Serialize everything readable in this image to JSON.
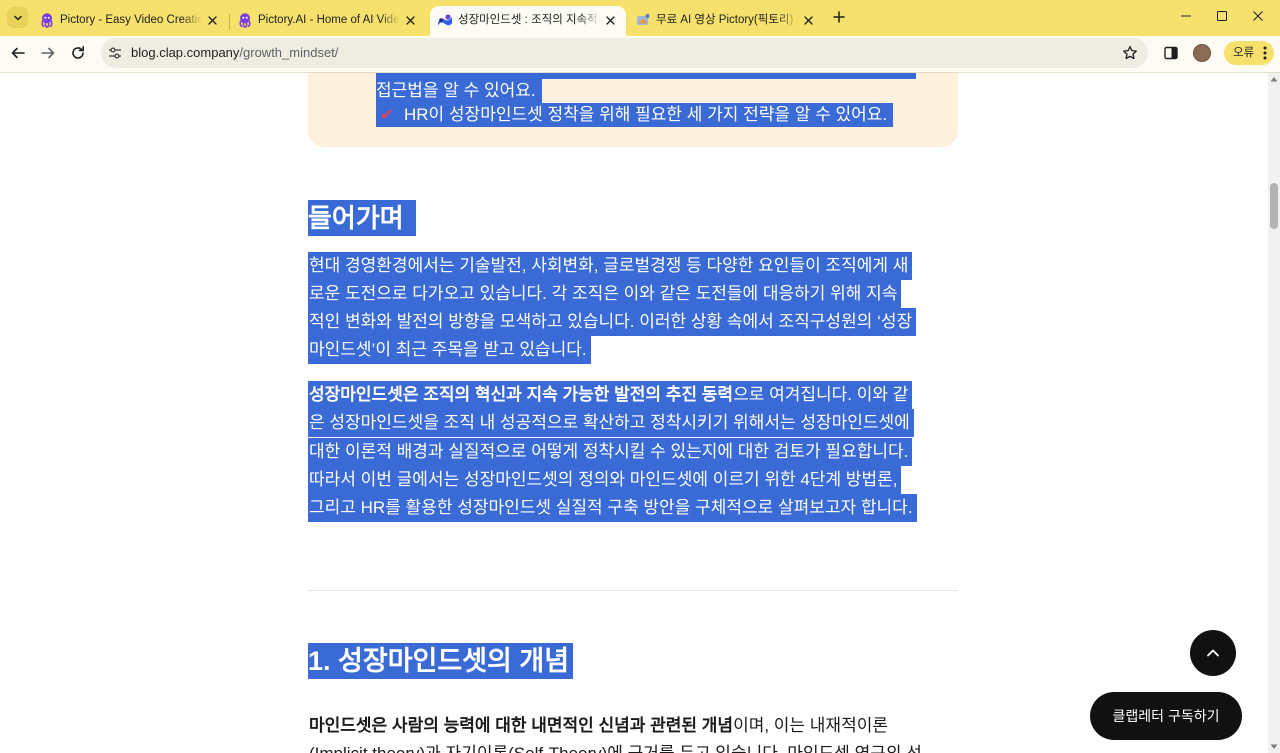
{
  "theme": {
    "frame_color": "#f5e16b",
    "toolbar_color": "#fdfcf4",
    "selection_color": "#3a6ad6",
    "summary_box_color": "#fdf1dd",
    "check_color": "#e8415f",
    "floating_button_color": "#111111"
  },
  "browser": {
    "tab_search_icon": "chevron-down-icon",
    "tabs": [
      {
        "title": "Pictory - Easy Video Creation",
        "icon": "pictory-octopus-icon",
        "active": false
      },
      {
        "title": "Pictory.AI - Home of AI Video",
        "icon": "pictory-octopus-icon",
        "active": false
      },
      {
        "title": "성장마인드셋 : 조직의 지속적",
        "icon": "clap-logo-icon",
        "active": true
      },
      {
        "title": "무료 AI 영상 Pictory(픽토리) A",
        "icon": "site-favicon-icon",
        "active": false
      }
    ],
    "tab_close_icon": "close-icon",
    "new_tab_icon": "plus-icon",
    "window_controls": {
      "minimize_icon": "minimize-icon",
      "maximize_icon": "maximize-icon",
      "close_icon": "close-icon"
    },
    "toolbar": {
      "back_icon": "back-arrow-icon",
      "forward_icon": "forward-arrow-icon",
      "reload_icon": "reload-icon",
      "site_info_icon": "tune-icon",
      "address": {
        "domain": "blog.clap.company",
        "path": "/growth_mindset/"
      },
      "bookmark_icon": "star-icon",
      "side_panel_icon": "side-panel-icon",
      "profile_icon": "avatar-icon",
      "error_chip": {
        "label": "오류",
        "menu_icon": "kebab-menu-icon"
      }
    }
  },
  "article": {
    "summary": {
      "check_icon": "check-mark-icon",
      "lines": [
        {
          "text": "접근법을 알 수 있어요.",
          "check": false
        },
        {
          "text": "HR이 성장마인드셋 정착을 위해 필요한 세 가지 전략을 알 수 있어요.",
          "check": true
        }
      ]
    },
    "intro": {
      "heading": "들어가며",
      "paragraph1": {
        "lines": [
          "현대 경영환경에서는 기술발전, 사회변화, 글로벌경쟁 등 다양한 요인들이 조직에게 새",
          "로운 도전으로 다가오고 있습니다. 각 조직은 이와 같은 도전들에 대응하기 위해 지속",
          "적인 변화와 발전의 방향을 모색하고 있습니다. 이러한 상황 속에서 조직구성원의 ‘성장",
          "마인드셋’이 최근 주목을 받고 있습니다."
        ]
      },
      "paragraph2": {
        "lines": [
          {
            "bold": "성장마인드셋은 조직의 혁신과 지속 가능한 발전의 추진 동력",
            "text": "으로 여겨집니다. 이와 같"
          },
          {
            "text": "은 성장마인드셋을 조직 내 성공적으로 확산하고 정착시키기 위해서는 성장마인드셋에"
          },
          {
            "text": "대한 이론적 배경과 실질적으로 어떻게 정착시킬 수 있는지에 대한 검토가 필요합니다."
          },
          {
            "text": "따라서 이번 글에서는 성장마인드셋의 정의와 마인드셋에 이르기 위한 4단계 방법론,"
          },
          {
            "text": "그리고 HR를 활용한 성장마인드셋 실질적 구축 방안을 구체적으로 살펴보고자 합니다."
          }
        ]
      }
    },
    "section1": {
      "heading": "1. 성장마인드셋의 개념",
      "paragraph1": {
        "lines": [
          {
            "bold": "마인드셋은 사람의 능력에 대한 내면적인 신념과 관련된 개념",
            "text": "이며, 이는 내재적이론"
          },
          {
            "text": "(Implicit theory)과 자기이론(Self-Theory)에 근거를 두고 있습니다. 마인드셋 연구의 선"
          }
        ]
      }
    }
  },
  "floating": {
    "scroll_top_icon": "chevron-up-icon",
    "subscribe_label": "클랩레터 구독하기"
  },
  "scrollbar": {
    "scroll_position_fraction": 0.16
  }
}
